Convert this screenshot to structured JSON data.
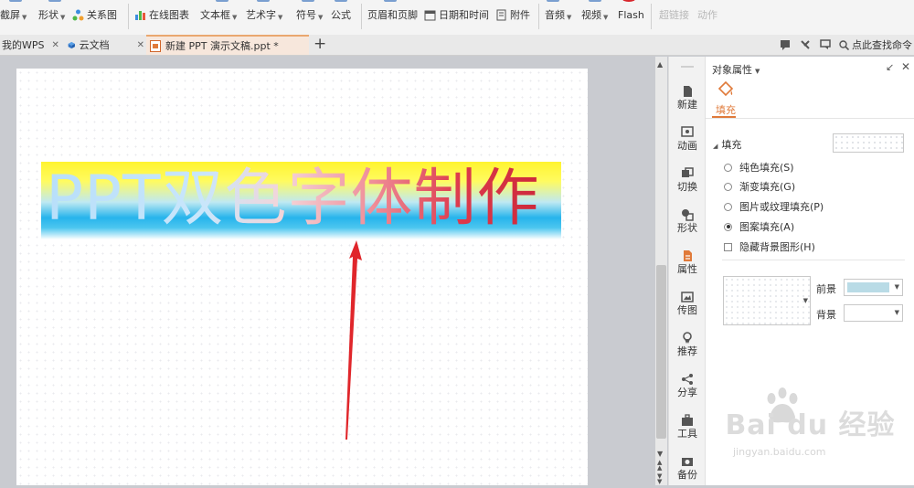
{
  "ribbon": {
    "items": [
      {
        "label": "截屏",
        "caret": true
      },
      {
        "label": "形状",
        "caret": true
      },
      {
        "label": "关系图",
        "caret": false
      },
      {
        "label": "在线图表",
        "caret": false
      },
      {
        "label": "文本框",
        "caret": true
      },
      {
        "label": "艺术字",
        "caret": true
      },
      {
        "label": "符号",
        "caret": true
      },
      {
        "label": "公式",
        "caret": false
      },
      {
        "label": "页眉和页脚",
        "caret": false
      },
      {
        "label": "日期和时间",
        "caret": false
      },
      {
        "label": "附件",
        "caret": false
      },
      {
        "label": "音频",
        "caret": true
      },
      {
        "label": "视频",
        "caret": true
      },
      {
        "label": "Flash",
        "caret": false
      },
      {
        "label": "超链接",
        "caret": false
      },
      {
        "label": "动作",
        "caret": false
      }
    ],
    "search_label": "点此查找命令"
  },
  "tabs": [
    {
      "label": "我的WPS"
    },
    {
      "label": "云文档"
    },
    {
      "label": "新建 PPT 演示文稿.ppt *"
    }
  ],
  "slide": {
    "wordart_text": "PPT双色字体制作"
  },
  "sidebar": {
    "items": [
      {
        "label": "新建"
      },
      {
        "label": "动画"
      },
      {
        "label": "切换"
      },
      {
        "label": "形状"
      },
      {
        "label": "属性"
      },
      {
        "label": "传图"
      },
      {
        "label": "推荐"
      },
      {
        "label": "分享"
      },
      {
        "label": "工具"
      },
      {
        "label": "备份"
      }
    ]
  },
  "panel": {
    "title": "对象属性",
    "tab_label": "填充",
    "section_label": "填充",
    "options": [
      {
        "label": "纯色填充(S)",
        "selected": false
      },
      {
        "label": "渐变填充(G)",
        "selected": false
      },
      {
        "label": "图片或纹理填充(P)",
        "selected": false
      },
      {
        "label": "图案填充(A)",
        "selected": true
      }
    ],
    "hide_bg_label": "隐藏背景图形(H)",
    "foreground_label": "前景",
    "background_label": "背景",
    "foreground_color": "#b9dbe6"
  },
  "watermark": {
    "brand": "Bai du 经验",
    "url": "jingyan.baidu.com"
  }
}
